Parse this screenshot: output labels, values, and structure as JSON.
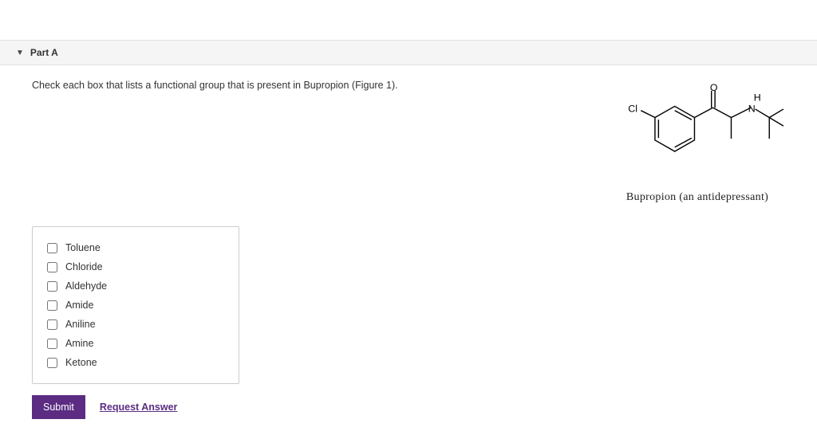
{
  "part": {
    "title": "Part A"
  },
  "instruction": "Check each box that lists a functional group that is present in Bupropion (Figure 1).",
  "figure": {
    "caption": "Bupropion (an antidepressant)",
    "labels": {
      "cl": "Cl",
      "o": "O",
      "n": "N",
      "h": "H"
    }
  },
  "options": [
    {
      "label": "Toluene"
    },
    {
      "label": "Chloride"
    },
    {
      "label": "Aldehyde"
    },
    {
      "label": "Amide"
    },
    {
      "label": "Aniline"
    },
    {
      "label": "Amine"
    },
    {
      "label": "Ketone"
    }
  ],
  "buttons": {
    "submit": "Submit",
    "request": "Request Answer"
  }
}
